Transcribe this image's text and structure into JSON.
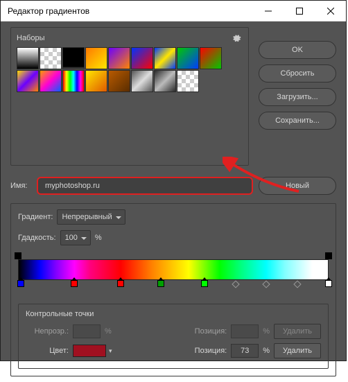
{
  "window": {
    "title": "Редактор градиентов"
  },
  "presets": {
    "label": "Наборы",
    "gradients": [
      {
        "css": "linear-gradient(to bottom,#fff,#000)"
      },
      {
        "css": "repeating-conic-gradient(#ccc 0 25%, #fff 0 50%) 0 0/12px 12px"
      },
      {
        "css": "linear-gradient(to bottom,#000 0%,#000 90%,transparent 100%)"
      },
      {
        "css": "linear-gradient(135deg,#ff7a00,#ffe600)"
      },
      {
        "css": "linear-gradient(135deg,#6a00ff,#ff8400)"
      },
      {
        "css": "linear-gradient(135deg,#0032ff,#ff0000)"
      },
      {
        "css": "linear-gradient(135deg,#003cff,#ffe600,#003cff)"
      },
      {
        "css": "linear-gradient(135deg,#00c800,#003cff)"
      },
      {
        "css": "linear-gradient(135deg,#ff0000,#00c800)"
      },
      {
        "css": "linear-gradient(135deg,#ffde00,#6a00ff,#ff8400)"
      },
      {
        "css": "linear-gradient(135deg,#ff9a00,#ff00d4,#0064ff)"
      },
      {
        "css": "linear-gradient(90deg,#ff0000,#ffff00,#00ff00,#00ffff,#0000ff,#ff00ff,#ff0000)"
      },
      {
        "css": "linear-gradient(135deg,#ffe600,#e05a00)"
      },
      {
        "css": "linear-gradient(135deg,#b85a00,#5a2d00)"
      },
      {
        "css": "linear-gradient(135deg,#555,#ddd,#555)"
      },
      {
        "css": "linear-gradient(135deg,#2a2a2a,#bbb,#2a2a2a)"
      },
      {
        "css": "repeating-conic-gradient(#ccc 0 25%, #fff 0 50%) 0 0/12px 12px"
      }
    ]
  },
  "buttons": {
    "ok": "OK",
    "reset": "Сбросить",
    "load": "Загрузить...",
    "save": "Сохранить...",
    "new": "Новый"
  },
  "name": {
    "label": "Имя:",
    "value": "myphotoshop.ru"
  },
  "gradient": {
    "type_label": "Градиент:",
    "type_value": "Непрерывный",
    "smoothness_label": "Гдадкость:",
    "smoothness_value": "100",
    "pct": "%",
    "opacity_stops": [
      {
        "pos": 0
      },
      {
        "pos": 100
      }
    ],
    "color_stops": [
      {
        "pos": 1,
        "color": "#0000ff"
      },
      {
        "pos": 18,
        "color": "#ff0000"
      },
      {
        "pos": 33,
        "color": "#ff0000"
      },
      {
        "pos": 46,
        "color": "#00a000"
      },
      {
        "pos": 60,
        "color": "#00ff00"
      },
      {
        "pos": 100,
        "color": "#ffffff"
      }
    ],
    "midpoints": [
      {
        "pos": 70
      },
      {
        "pos": 80
      },
      {
        "pos": 90
      }
    ]
  },
  "control_points": {
    "title": "Контрольные точки",
    "opacity_label": "Непрозр.:",
    "position_label": "Позиция:",
    "color_label": "Цвет:",
    "delete_label": "Удалить",
    "color_value": "#a01020",
    "position_value": "73",
    "pct": "%"
  }
}
